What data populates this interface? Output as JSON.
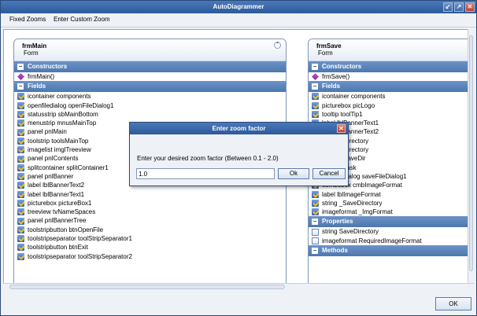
{
  "window": {
    "title": "AutoDiagrammer"
  },
  "titlebar_buttons": [
    "restore-icon",
    "maximize-icon",
    "close-icon"
  ],
  "menu": {
    "items": [
      "Fixed Zooms",
      "Enter Custom Zoom"
    ]
  },
  "classes": [
    {
      "name": "frmMain",
      "kind": "Form",
      "sections": [
        {
          "label": "Constructors",
          "items": [
            "frmMain()"
          ]
        },
        {
          "label": "Fields",
          "items": [
            "icontainer components",
            "openfiledialog openFileDialog1",
            "statusstrip sbMainBottom",
            "menustrip mnusMainTop",
            "panel pnlMain",
            "toolstrip toolsMainTop",
            "imagelist imglTreeview",
            "panel pnlContents",
            "splitcontainer splitContainer1",
            "panel pnlBanner",
            "label lblBannerText2",
            "label lblBannerText1",
            "picturebox pictureBox1",
            "treeview tvNameSpaces",
            "panel pnlBannerTree",
            "toolstripbutton btnOpenFile",
            "toolstripseparator toolStripSeparator1",
            "toolstripbutton btnExit",
            "toolstripseparator toolStripSeparator2"
          ]
        }
      ]
    },
    {
      "name": "frmSave",
      "kind": "Form",
      "sections": [
        {
          "label": "Constructors",
          "items": [
            "frmSave()"
          ]
        },
        {
          "label": "Fields",
          "items": [
            "icontainer components",
            "picturebox picLogo",
            "tooltip toolTip1",
            "label lblBannerText1",
            "label lblBannerText2",
            "label lblDirectory",
            "label lblDirectory",
            "label lblSaveDir",
            "label lblTask",
            "savefiledialog saveFileDialog1",
            "combobox cmbImageFormat",
            "label lblImageFormat",
            "string _SaveDirectory",
            "imageformat _ImgFormat"
          ]
        },
        {
          "label": "Properties",
          "items": [
            "string SaveDirectory",
            "imageformat RequiredImageFormat"
          ]
        },
        {
          "label": "Methods",
          "items": []
        }
      ]
    }
  ],
  "dialog": {
    "title": "Enter zoom factor",
    "prompt": "Enter your desired zoom factor (Between 0.1 - 2.0)",
    "value": "1.0",
    "ok_label": "Ok",
    "cancel_label": "Cancel"
  },
  "footer": {
    "ok_label": "OK"
  }
}
